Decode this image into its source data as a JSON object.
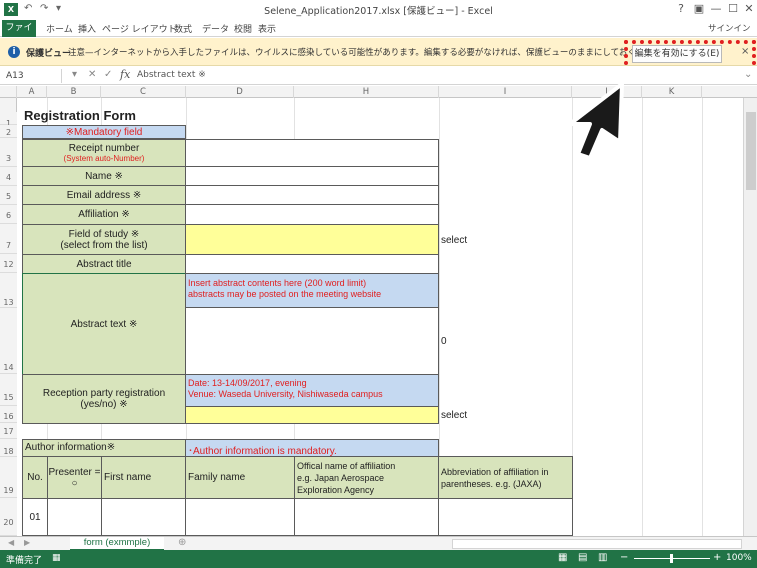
{
  "window": {
    "title": "Selene_Application2017.xlsx  [保護ビュー] - Excel",
    "buttons": [
      "?",
      "▣",
      "—",
      "☐",
      "✕"
    ],
    "signin": "サインイン"
  },
  "ribbon": {
    "file_tab": "ファイル",
    "tabs": [
      "ホーム",
      "挿入",
      "ページ レイアウト",
      "数式",
      "データ",
      "校閲",
      "表示"
    ]
  },
  "protected_view": {
    "title": "保護ビュー",
    "message": "注意—インターネットから入手したファイルは、ウイルスに感染している可能性があります。編集する必要がなければ、保護ビューのままにしておくことをお勧めします。",
    "enable_button": "編集を有効にする(E)",
    "close": "×"
  },
  "formula_bar": {
    "name_box": "A13",
    "fx": "fx",
    "content": "Abstract text ※"
  },
  "columns": [
    "A",
    "B",
    "C",
    "D",
    "H",
    "I",
    "J",
    "K"
  ],
  "rows": [
    "1",
    "2",
    "3",
    "4",
    "5",
    "6",
    "7",
    "12",
    "13",
    "14",
    "15",
    "16",
    "17",
    "18",
    "19",
    "20"
  ],
  "form": {
    "title": "Registration Form",
    "mandatory": "※Mandatory field",
    "receipt_label": "Receipt number",
    "receipt_note": "(System auto-Number)",
    "name_label": "Name ※",
    "email_label": "Email address ※",
    "affiliation_label": "Affiliation ※",
    "field_label_1": "Field of study ※",
    "field_label_2": "(select from the list)",
    "field_value": "select",
    "abstract_title_label": "Abstract title",
    "abstract_text_label": "Abstract text ※",
    "abstract_note_1": "Insert abstract contents here (200 word limit)",
    "abstract_note_2": "abstracts may be posted on the meeting website",
    "abstract_count": "0",
    "reception_label_1": "Reception party registration",
    "reception_label_2": "(yes/no) ※",
    "reception_date": "Date:  13-14/09/2017, evening",
    "reception_venue": "Venue: Waseda University, Nishiwaseda campus",
    "reception_value": "select",
    "author_info": "Author information※",
    "author_mandatory": "･Author information is mandatory.",
    "hdr_no": "No.",
    "hdr_presenter_1": "Presenter =",
    "hdr_presenter_2": "○",
    "hdr_first": "First name",
    "hdr_family": "Family name",
    "hdr_affil_1": "Offical name of affiliation",
    "hdr_affil_2": "e.g. Japan Aerospace",
    "hdr_affil_3": "Exploration Agency",
    "hdr_abbr_1": "Abbreviation of affiliation in",
    "hdr_abbr_2": "parentheses. e.g. (JAXA)",
    "row_01": "01"
  },
  "sheet": {
    "tab_label": "form (exmmple)",
    "add": "⊕"
  },
  "status": {
    "ready": "準備完了",
    "zoom": "100%"
  }
}
